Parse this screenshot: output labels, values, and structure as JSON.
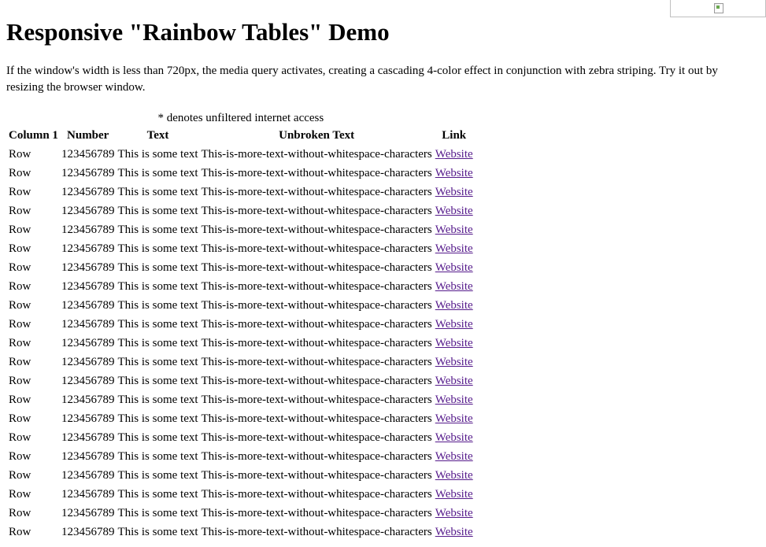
{
  "page": {
    "title": "Responsive \"Rainbow Tables\" Demo",
    "intro": "If the window's width is less than 720px, the media query activates, creating a cascading 4-color effect in conjunction with zebra striping. Try it out by resizing the browser window."
  },
  "table": {
    "caption": "* denotes unfiltered internet access",
    "headers": [
      "Column 1",
      "Number",
      "Text",
      "Unbroken Text",
      "Link"
    ],
    "rows": [
      [
        "Row",
        "123456789",
        "This is some text",
        "This-is-more-text-without-whitespace-characters",
        "Website"
      ],
      [
        "Row",
        "123456789",
        "This is some text",
        "This-is-more-text-without-whitespace-characters",
        "Website"
      ],
      [
        "Row",
        "123456789",
        "This is some text",
        "This-is-more-text-without-whitespace-characters",
        "Website"
      ],
      [
        "Row",
        "123456789",
        "This is some text",
        "This-is-more-text-without-whitespace-characters",
        "Website"
      ],
      [
        "Row",
        "123456789",
        "This is some text",
        "This-is-more-text-without-whitespace-characters",
        "Website"
      ],
      [
        "Row",
        "123456789",
        "This is some text",
        "This-is-more-text-without-whitespace-characters",
        "Website"
      ],
      [
        "Row",
        "123456789",
        "This is some text",
        "This-is-more-text-without-whitespace-characters",
        "Website"
      ],
      [
        "Row",
        "123456789",
        "This is some text",
        "This-is-more-text-without-whitespace-characters",
        "Website"
      ],
      [
        "Row",
        "123456789",
        "This is some text",
        "This-is-more-text-without-whitespace-characters",
        "Website"
      ],
      [
        "Row",
        "123456789",
        "This is some text",
        "This-is-more-text-without-whitespace-characters",
        "Website"
      ],
      [
        "Row",
        "123456789",
        "This is some text",
        "This-is-more-text-without-whitespace-characters",
        "Website"
      ],
      [
        "Row",
        "123456789",
        "This is some text",
        "This-is-more-text-without-whitespace-characters",
        "Website"
      ],
      [
        "Row",
        "123456789",
        "This is some text",
        "This-is-more-text-without-whitespace-characters",
        "Website"
      ],
      [
        "Row",
        "123456789",
        "This is some text",
        "This-is-more-text-without-whitespace-characters",
        "Website"
      ],
      [
        "Row",
        "123456789",
        "This is some text",
        "This-is-more-text-without-whitespace-characters",
        "Website"
      ],
      [
        "Row",
        "123456789",
        "This is some text",
        "This-is-more-text-without-whitespace-characters",
        "Website"
      ],
      [
        "Row",
        "123456789",
        "This is some text",
        "This-is-more-text-without-whitespace-characters",
        "Website"
      ],
      [
        "Row",
        "123456789",
        "This is some text",
        "This-is-more-text-without-whitespace-characters",
        "Website"
      ],
      [
        "Row",
        "123456789",
        "This is some text",
        "This-is-more-text-without-whitespace-characters",
        "Website"
      ],
      [
        "Row",
        "123456789",
        "This is some text",
        "This-is-more-text-without-whitespace-characters",
        "Website"
      ],
      [
        "Row",
        "123456789",
        "This is some text",
        "This-is-more-text-without-whitespace-characters",
        "Website"
      ]
    ]
  },
  "colors": {
    "text": "#000000",
    "visited_link": "#551a8b",
    "background": "#ffffff"
  },
  "icons": {
    "top_right_image": "broken-image-icon"
  }
}
